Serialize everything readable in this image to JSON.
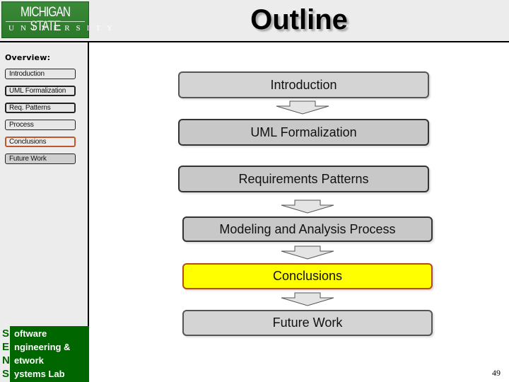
{
  "header": {
    "logo": {
      "line1": "MICHIGAN STATE",
      "line2": "UNIVERSITY"
    },
    "title": "Outline"
  },
  "sidebar": {
    "overview_label": "Overview:",
    "items": [
      {
        "label": "Introduction",
        "state": "normal"
      },
      {
        "label": "UML Formalization",
        "state": "normal"
      },
      {
        "label": "Req. Patterns",
        "state": "bold"
      },
      {
        "label": "Process",
        "state": "normal"
      },
      {
        "label": "Conclusions",
        "state": "active"
      },
      {
        "label": "Future Work",
        "state": "dark"
      }
    ],
    "lab": {
      "rows": [
        {
          "cap": "S",
          "rest": "oftware"
        },
        {
          "cap": "E",
          "rest": "ngineering &"
        },
        {
          "cap": "N",
          "rest": "etwork"
        },
        {
          "cap": "S",
          "rest": "ystems Lab"
        }
      ]
    }
  },
  "flow": {
    "steps": [
      {
        "label": "Introduction",
        "state": "light"
      },
      {
        "label": "UML Formalization",
        "state": "normal"
      },
      {
        "label": "Requirements Patterns",
        "state": "normal"
      },
      {
        "label": "Modeling and Analysis Process",
        "state": "normal"
      },
      {
        "label": "Conclusions",
        "state": "current"
      },
      {
        "label": "Future Work",
        "state": "light"
      }
    ]
  },
  "colors": {
    "msu_green": "#2a7a2a",
    "lab_green": "#006600",
    "highlight": "#ffff00",
    "active_border": "#c0562e"
  },
  "page_number": "49"
}
